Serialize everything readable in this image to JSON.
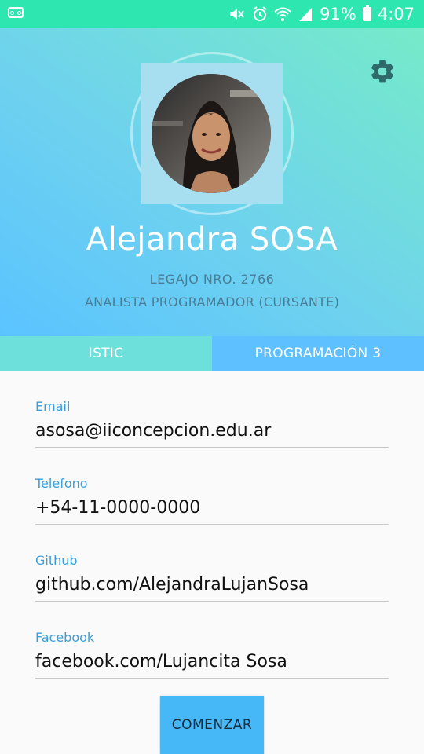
{
  "status_bar": {
    "battery": "91%",
    "time": "4:07",
    "background_color": "#2ee6b0",
    "icons": [
      "voicemail-icon",
      "mute-icon",
      "alarm-icon",
      "wifi-icon",
      "signal-icon",
      "battery-icon"
    ]
  },
  "header": {
    "gradient_colors": [
      "#5bc3ff",
      "#76eac9"
    ],
    "settings_icon": "gear-icon",
    "name": "Alejandra SOSA",
    "legajo": "LEGAJO NRO. 2766",
    "role": "ANALISTA PROGRAMADOR (CURSANTE)"
  },
  "tabs": [
    {
      "label": "ISTIC",
      "color": "#6ee0dc"
    },
    {
      "label": "PROGRAMACIÓN 3",
      "color": "#5ec0ff"
    }
  ],
  "fields": [
    {
      "label": "Email",
      "value": "asosa@iiconcepcion.edu.ar"
    },
    {
      "label": "Telefono",
      "value": "+54-11-0000-0000"
    },
    {
      "label": "Github",
      "value": "github.com/AlejandraLujanSosa"
    },
    {
      "label": "Facebook",
      "value": "facebook.com/Lujancita Sosa"
    }
  ],
  "start_button": {
    "label": "COMENZAR",
    "color": "#46b8f7"
  }
}
